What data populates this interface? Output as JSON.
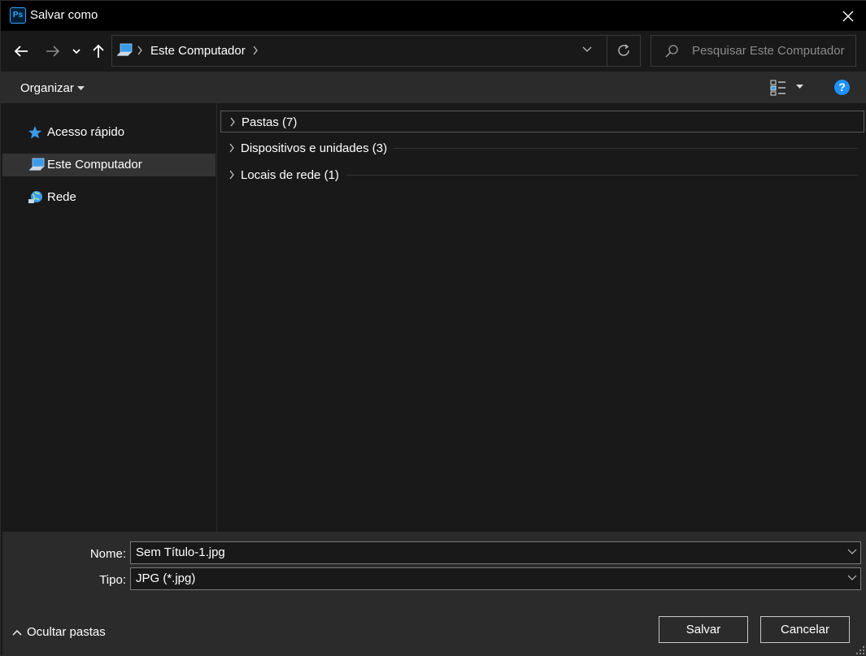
{
  "window": {
    "app_icon_text": "Ps",
    "title": "Salvar como"
  },
  "address": {
    "breadcrumb": "Este Computador",
    "search_placeholder": "Pesquisar Este Computador"
  },
  "toolbar": {
    "organize_label": "Organizar",
    "help_label": "?"
  },
  "sidebar": {
    "items": [
      {
        "label": "Acesso rápido",
        "icon": "star-icon",
        "selected": false
      },
      {
        "label": "Este Computador",
        "icon": "computer-icon",
        "selected": true
      },
      {
        "label": "Rede",
        "icon": "network-icon",
        "selected": false
      }
    ]
  },
  "content": {
    "groups": [
      {
        "label": "Pastas (7)"
      },
      {
        "label": "Dispositivos e unidades (3)"
      },
      {
        "label": "Locais de rede (1)"
      }
    ]
  },
  "form": {
    "name_label": "Nome:",
    "name_value": "Sem Título-1.jpg",
    "type_label": "Tipo:",
    "type_value": "JPG (*.jpg)"
  },
  "footer": {
    "hide_folders_label": "Ocultar pastas",
    "save_label": "Salvar",
    "cancel_label": "Cancelar"
  },
  "colors": {
    "accent_blue": "#1e90ff",
    "ps_blue": "#31a8ff",
    "panel_bg": "#2b2b2b",
    "main_bg": "#191919"
  }
}
